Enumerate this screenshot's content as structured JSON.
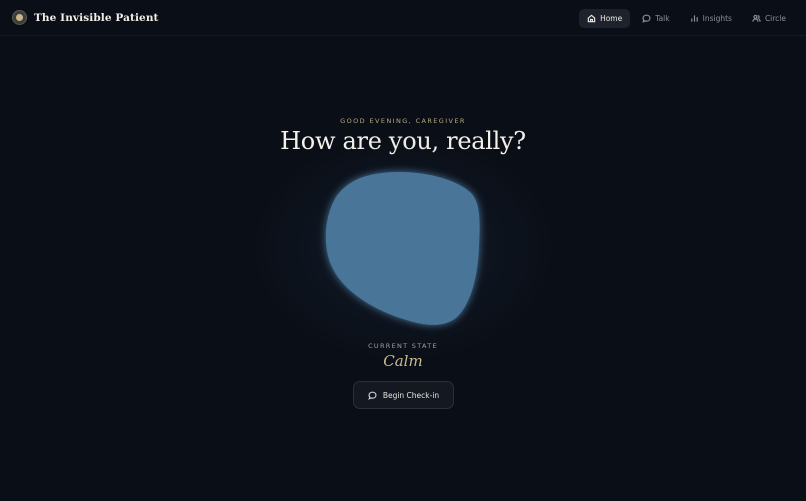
{
  "app": {
    "title": "The Invisible Patient"
  },
  "nav": {
    "items": [
      {
        "label": "Home",
        "icon": "home-icon",
        "active": true
      },
      {
        "label": "Talk",
        "icon": "chat-bubble-icon",
        "active": false
      },
      {
        "label": "Insights",
        "icon": "bar-chart-icon",
        "active": false
      },
      {
        "label": "Circle",
        "icon": "people-icon",
        "active": false
      }
    ]
  },
  "hero": {
    "greeting": "GOOD EVENING, CAREGIVER",
    "headline": "How are you, really?",
    "state_label": "CURRENT STATE",
    "state_value": "Calm",
    "checkin_label": "Begin Check-in",
    "checkin_icon": "chat-bubble-icon"
  },
  "colors": {
    "background": "#0a0e16",
    "mood_blob": "#4a7499",
    "accent_gold": "#c9bb8f"
  }
}
